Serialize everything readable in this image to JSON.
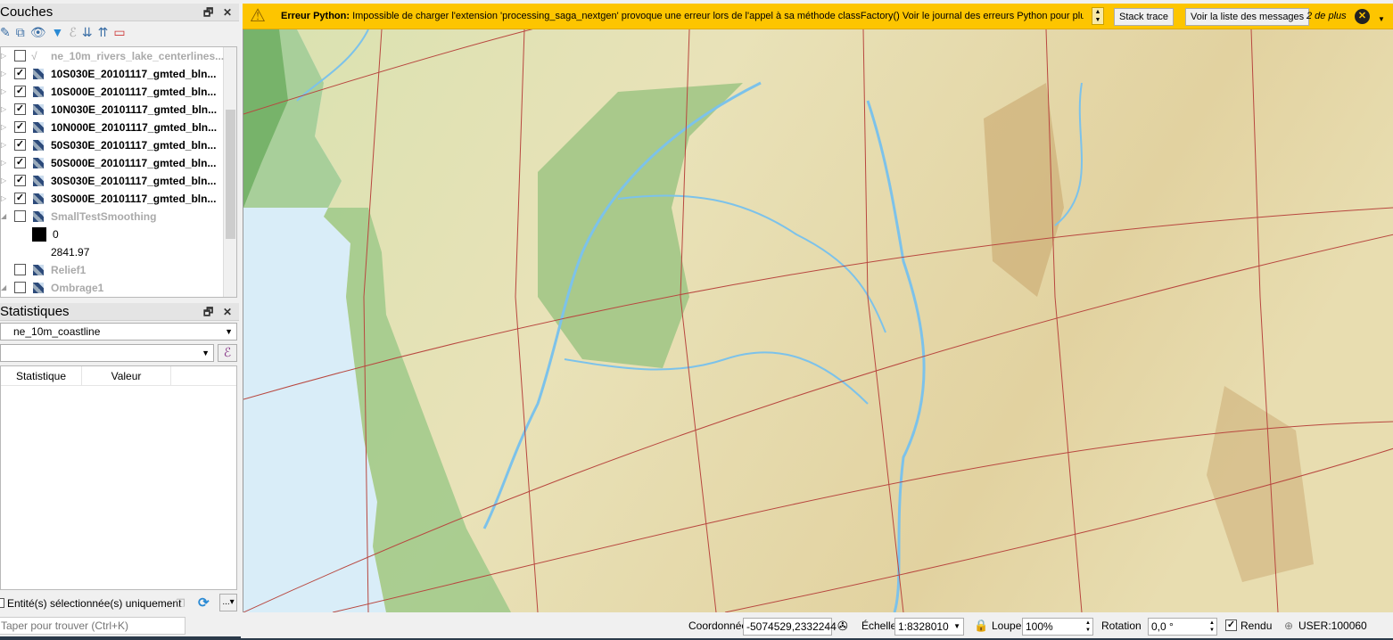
{
  "layers_panel": {
    "title": "Couches",
    "items": [
      {
        "label": "ne_10m_rivers_lake_centerlines...",
        "checked": false,
        "icon": "line-layer-icon",
        "dim": true
      },
      {
        "label": "10S030E_20101117_gmted_bln...",
        "checked": true,
        "icon": "raster-layer-icon"
      },
      {
        "label": "10S000E_20101117_gmted_bln...",
        "checked": true,
        "icon": "raster-layer-icon"
      },
      {
        "label": "10N030E_20101117_gmted_bln...",
        "checked": true,
        "icon": "raster-layer-icon"
      },
      {
        "label": "10N000E_20101117_gmted_bln...",
        "checked": true,
        "icon": "raster-layer-icon"
      },
      {
        "label": "50S030E_20101117_gmted_bln...",
        "checked": true,
        "icon": "raster-layer-icon"
      },
      {
        "label": "50S000E_20101117_gmted_bln...",
        "checked": true,
        "icon": "raster-layer-icon"
      },
      {
        "label": "30S030E_20101117_gmted_bln...",
        "checked": true,
        "icon": "raster-layer-icon"
      },
      {
        "label": "30S000E_20101117_gmted_bln...",
        "checked": true,
        "icon": "raster-layer-icon"
      },
      {
        "label": "SmallTestSmoothing",
        "checked": false,
        "icon": "raster-layer-icon",
        "dim": true
      },
      {
        "legend_min": "0",
        "legend_max": "2841.97"
      },
      {
        "label": "Relief1",
        "checked": false,
        "icon": "raster-layer-icon",
        "dim": true
      },
      {
        "label": "Ombrage1",
        "checked": false,
        "icon": "raster-layer-icon",
        "dim": true
      }
    ]
  },
  "stats_panel": {
    "title": "Statistiques",
    "layer": "ne_10m_coastline",
    "field": "",
    "columns": [
      "Statistique",
      "Valeur"
    ],
    "selected_only_label": "Entité(s) sélectionnée(s) uniquement",
    "selected_only": false
  },
  "search": {
    "placeholder": "Taper pour trouver (Ctrl+K)"
  },
  "message": {
    "title": "Erreur Python:",
    "text": "Impossible de charger l'extension 'processing_saga_nextgen' provoque une erreur lors de l'appel à sa méthode classFactory() Voir le journal des erreurs Python pour plus de détails",
    "stack_trace": "Stack trace",
    "view_messages": "Voir la liste des messages",
    "more": "2 de plus",
    "color": "#fdc500"
  },
  "status": {
    "coord_label": "Coordonnée",
    "coord": "-5074529,2332244",
    "scale_label": "Échelle",
    "scale": "1:8328010",
    "magnifier_label": "Loupe",
    "magnifier": "100%",
    "rotation_label": "Rotation",
    "rotation": "0,0 °",
    "render_label": "Rendu",
    "render": true,
    "crs": "USER:100060"
  }
}
